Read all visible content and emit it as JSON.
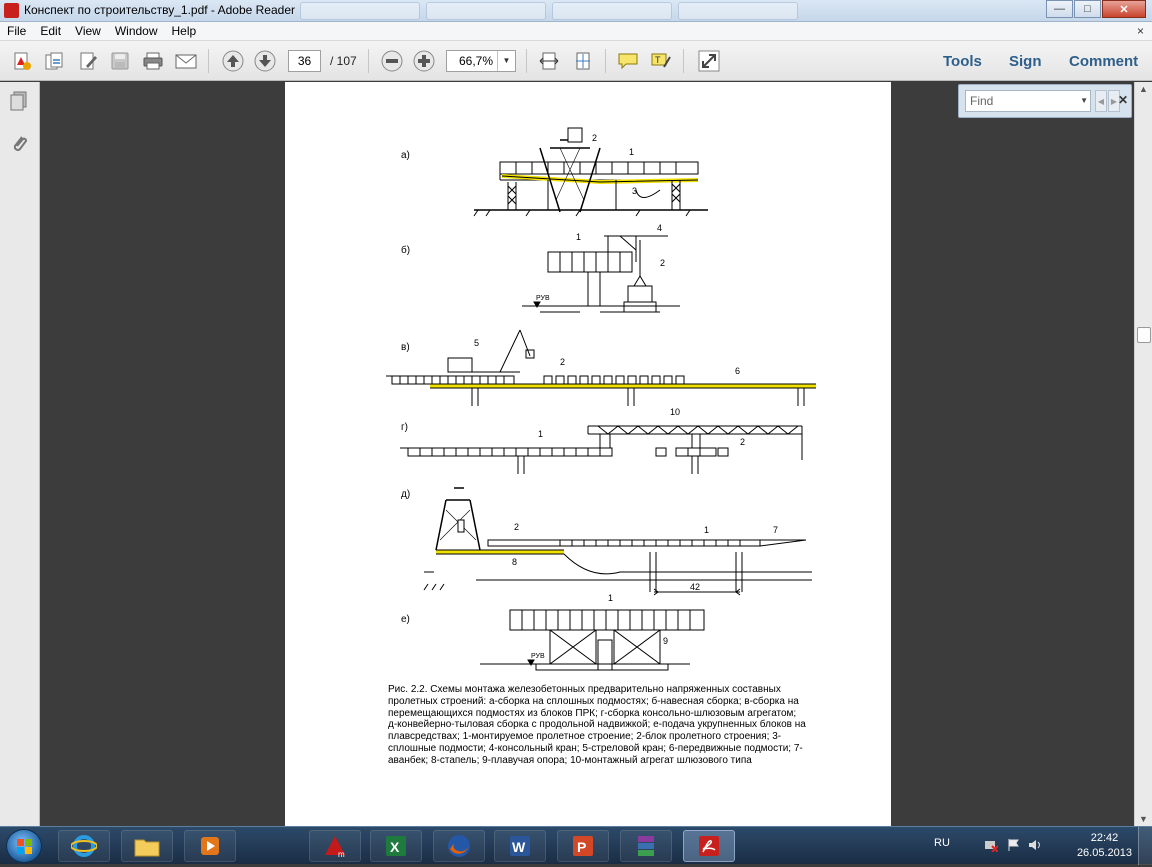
{
  "window": {
    "title": "Конспект по строительству_1.pdf - Adobe Reader"
  },
  "menubar": {
    "items": [
      "File",
      "Edit",
      "View",
      "Window",
      "Help"
    ],
    "close_glyph": "×"
  },
  "toolbar": {
    "current_page": "36",
    "page_total": "/ 107",
    "zoom": "66,7%",
    "tools_label": "Tools",
    "sign_label": "Sign",
    "comment_label": "Comment"
  },
  "find": {
    "placeholder": "Find"
  },
  "document": {
    "figure_labels": [
      "а)",
      "б)",
      "в)",
      "г)",
      "д)",
      "е)"
    ],
    "callouts": {
      "a": [
        "1",
        "2",
        "3"
      ],
      "b": [
        "1",
        "2",
        "4"
      ],
      "v": [
        "2",
        "5",
        "6"
      ],
      "g": [
        "1",
        "2",
        "10"
      ],
      "d": [
        "1",
        "2",
        "7",
        "8",
        "42"
      ],
      "e": [
        "1",
        "9"
      ]
    },
    "water_level_label": "РУВ",
    "caption": "Рис. 2.2. Схемы монтажа железобетонных предварительно напряженных составных пролетных строений: а-сборка на сплошных подмостях; б-навесная сборка; в-сборка на перемещающихся подмостях из блоков ПРК; г-сборка консольно-шлюзовым агрегатом; д-конвейерно-тыловая сборка с продольной надвижкой; е-подача укрупненных блоков на плавсредствах; 1-монтируемое пролетное строение; 2-блок пролетного строения; 3-сплошные подмости; 4-консольный кран; 5-стреловой кран; 6-передвижные подмости; 7-аванбек; 8-стапель; 9-плавучая опора; 10-монтажный агрегат шлюзового типа"
  },
  "taskbar": {
    "language": "RU",
    "time": "22:42",
    "date": "26.05.2013",
    "apps": [
      "internet-explorer",
      "file-explorer",
      "media-player",
      "autocad",
      "excel",
      "firefox",
      "word",
      "powerpoint",
      "winrar",
      "adobe-reader"
    ]
  },
  "colors": {
    "highlight": "#f1e100",
    "doc_background": "#3c3c3c",
    "accent_link": "#2e5f8a"
  }
}
